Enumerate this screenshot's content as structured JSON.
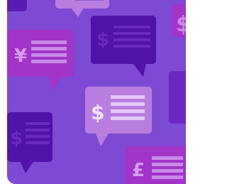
{
  "colors": {
    "background": "#7e4ad3",
    "bubble_magenta": "#a234c8",
    "bubble_indigo": "#4f13a8",
    "bubble_lilac": "#b77ee0",
    "bubble_violet": "#8b45d4",
    "line_light": "#c98ae8",
    "line_dark": "#7b35c6",
    "line_on_lilac": "#8a57cf"
  },
  "bubbles": [
    {
      "currency_icon": "yen-icon",
      "symbol": "¥"
    },
    {
      "currency_icon": "dollar-icon",
      "symbol": "$"
    },
    {
      "currency_icon": "dollar-icon",
      "symbol": "$"
    },
    {
      "currency_icon": "dollar-icon",
      "symbol": "$"
    },
    {
      "currency_icon": "pound-icon",
      "symbol": "£"
    },
    {
      "currency_icon": "dollar-icon",
      "symbol": "$"
    }
  ]
}
